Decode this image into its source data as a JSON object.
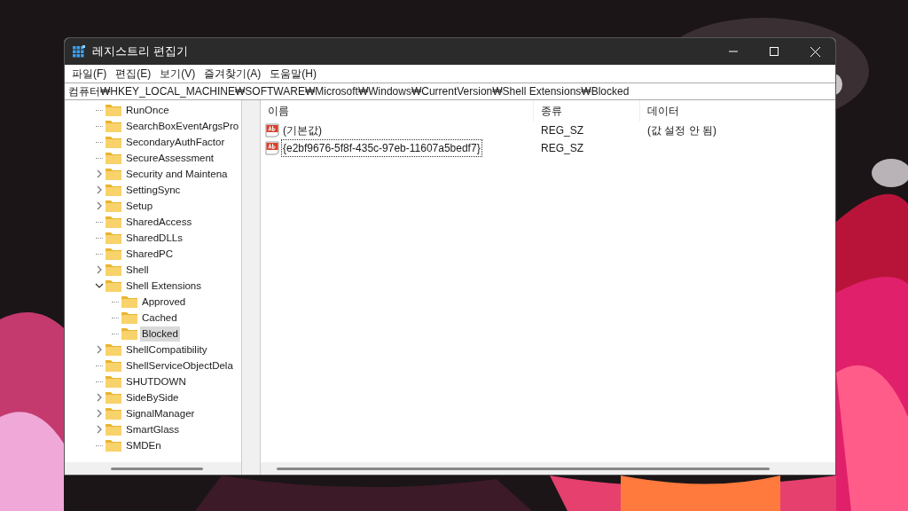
{
  "window": {
    "title": "레지스트리 편집기"
  },
  "menu": [
    "파일(F)",
    "편집(E)",
    "보기(V)",
    "즐겨찾기(A)",
    "도움말(H)"
  ],
  "address": "컴퓨터₩HKEY_LOCAL_MACHINE₩SOFTWARE₩Microsoft₩Windows₩CurrentVersion₩Shell Extensions₩Blocked",
  "tree": [
    {
      "label": "RunOnce",
      "kind": "leaf",
      "selected": false
    },
    {
      "label": "SearchBoxEventArgsPro",
      "kind": "leaf",
      "selected": false
    },
    {
      "label": "SecondaryAuthFactor",
      "kind": "leaf",
      "selected": false
    },
    {
      "label": "SecureAssessment",
      "kind": "leaf",
      "selected": false
    },
    {
      "label": "Security and Maintena",
      "kind": "collapsed",
      "selected": false
    },
    {
      "label": "SettingSync",
      "kind": "collapsed",
      "selected": false
    },
    {
      "label": "Setup",
      "kind": "collapsed",
      "selected": false
    },
    {
      "label": "SharedAccess",
      "kind": "leaf",
      "selected": false
    },
    {
      "label": "SharedDLLs",
      "kind": "leaf",
      "selected": false
    },
    {
      "label": "SharedPC",
      "kind": "leaf",
      "selected": false
    },
    {
      "label": "Shell",
      "kind": "collapsed",
      "selected": false
    },
    {
      "label": "Shell Extensions",
      "kind": "expanded",
      "selected": false,
      "children": [
        {
          "label": "Approved",
          "kind": "leaf",
          "selected": false
        },
        {
          "label": "Cached",
          "kind": "leaf",
          "selected": false
        },
        {
          "label": "Blocked",
          "kind": "leaf",
          "selected": true
        }
      ]
    },
    {
      "label": "ShellCompatibility",
      "kind": "collapsed",
      "selected": false
    },
    {
      "label": "ShellServiceObjectDela",
      "kind": "leaf",
      "selected": false
    },
    {
      "label": "SHUTDOWN",
      "kind": "leaf",
      "selected": false
    },
    {
      "label": "SideBySide",
      "kind": "collapsed",
      "selected": false
    },
    {
      "label": "SignalManager",
      "kind": "collapsed",
      "selected": false
    },
    {
      "label": "SmartGlass",
      "kind": "collapsed",
      "selected": false
    },
    {
      "label": "SMDEn",
      "kind": "leaf",
      "selected": false
    }
  ],
  "table": {
    "columns": [
      "이름",
      "종류",
      "데이터"
    ],
    "rows": [
      {
        "name": "(기본값)",
        "type": "REG_SZ",
        "data": "(값 설정 안 됨)",
        "focused": false
      },
      {
        "name": "{e2bf9676-5f8f-435c-97eb-11607a5bedf7}",
        "type": "REG_SZ",
        "focused": true
      }
    ]
  }
}
